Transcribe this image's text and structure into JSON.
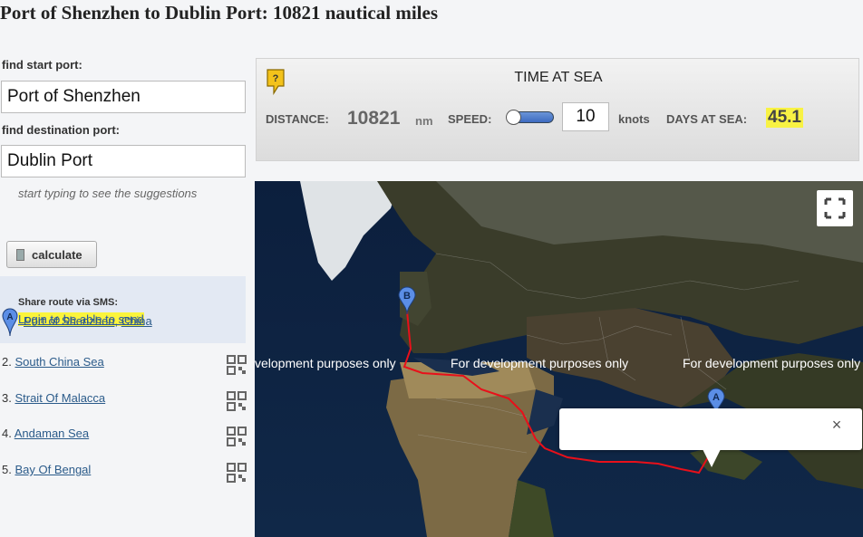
{
  "page": {
    "title": "Port of Shenzhen to Dublin Port: 10821 nautical miles"
  },
  "form": {
    "start_label": "find start port:",
    "start_value": "Port of Shenzhen",
    "dest_label": "find destination port:",
    "dest_value": "Dublin Port",
    "hint": "start typing to see the suggestions",
    "calculate_label": "calculate"
  },
  "sms": {
    "title": "Share route via SMS:",
    "link": "Login to be able to send"
  },
  "route": {
    "start_marker": "A",
    "start_port": "Port of Shenzhen",
    "separator": ", ",
    "start_country": "China",
    "legs": [
      {
        "num": "2.",
        "name": "South China Sea"
      },
      {
        "num": "3.",
        "name": "Strait Of Malacca"
      },
      {
        "num": "4.",
        "name": "Andaman Sea"
      },
      {
        "num": "5.",
        "name": "Bay Of Bengal"
      }
    ]
  },
  "panel": {
    "help_symbol": "?",
    "title": "TIME AT SEA",
    "distance_label": "DISTANCE:",
    "distance_value": "10821",
    "distance_unit": "nm",
    "speed_label": "SPEED:",
    "speed_value": "10",
    "speed_unit": "knots",
    "days_label": "DAYS AT SEA:",
    "days_value": "45.1"
  },
  "map": {
    "watermarks": [
      "velopment purposes only",
      "For development purposes only",
      "For development purposes only"
    ],
    "marker_a": "A",
    "marker_b": "B",
    "close_symbol": "×",
    "route_color": "#e8101a",
    "marker_color": "#5b8ee6",
    "icons": [
      "fullscreen-icon",
      "close-icon",
      "map-pin-icon",
      "help-icon",
      "calculator-icon",
      "qr-code-icon"
    ]
  },
  "colors": {
    "highlight": "#f8f244",
    "link": "#2b5b8a",
    "sms_bg": "#e3e9f3"
  }
}
